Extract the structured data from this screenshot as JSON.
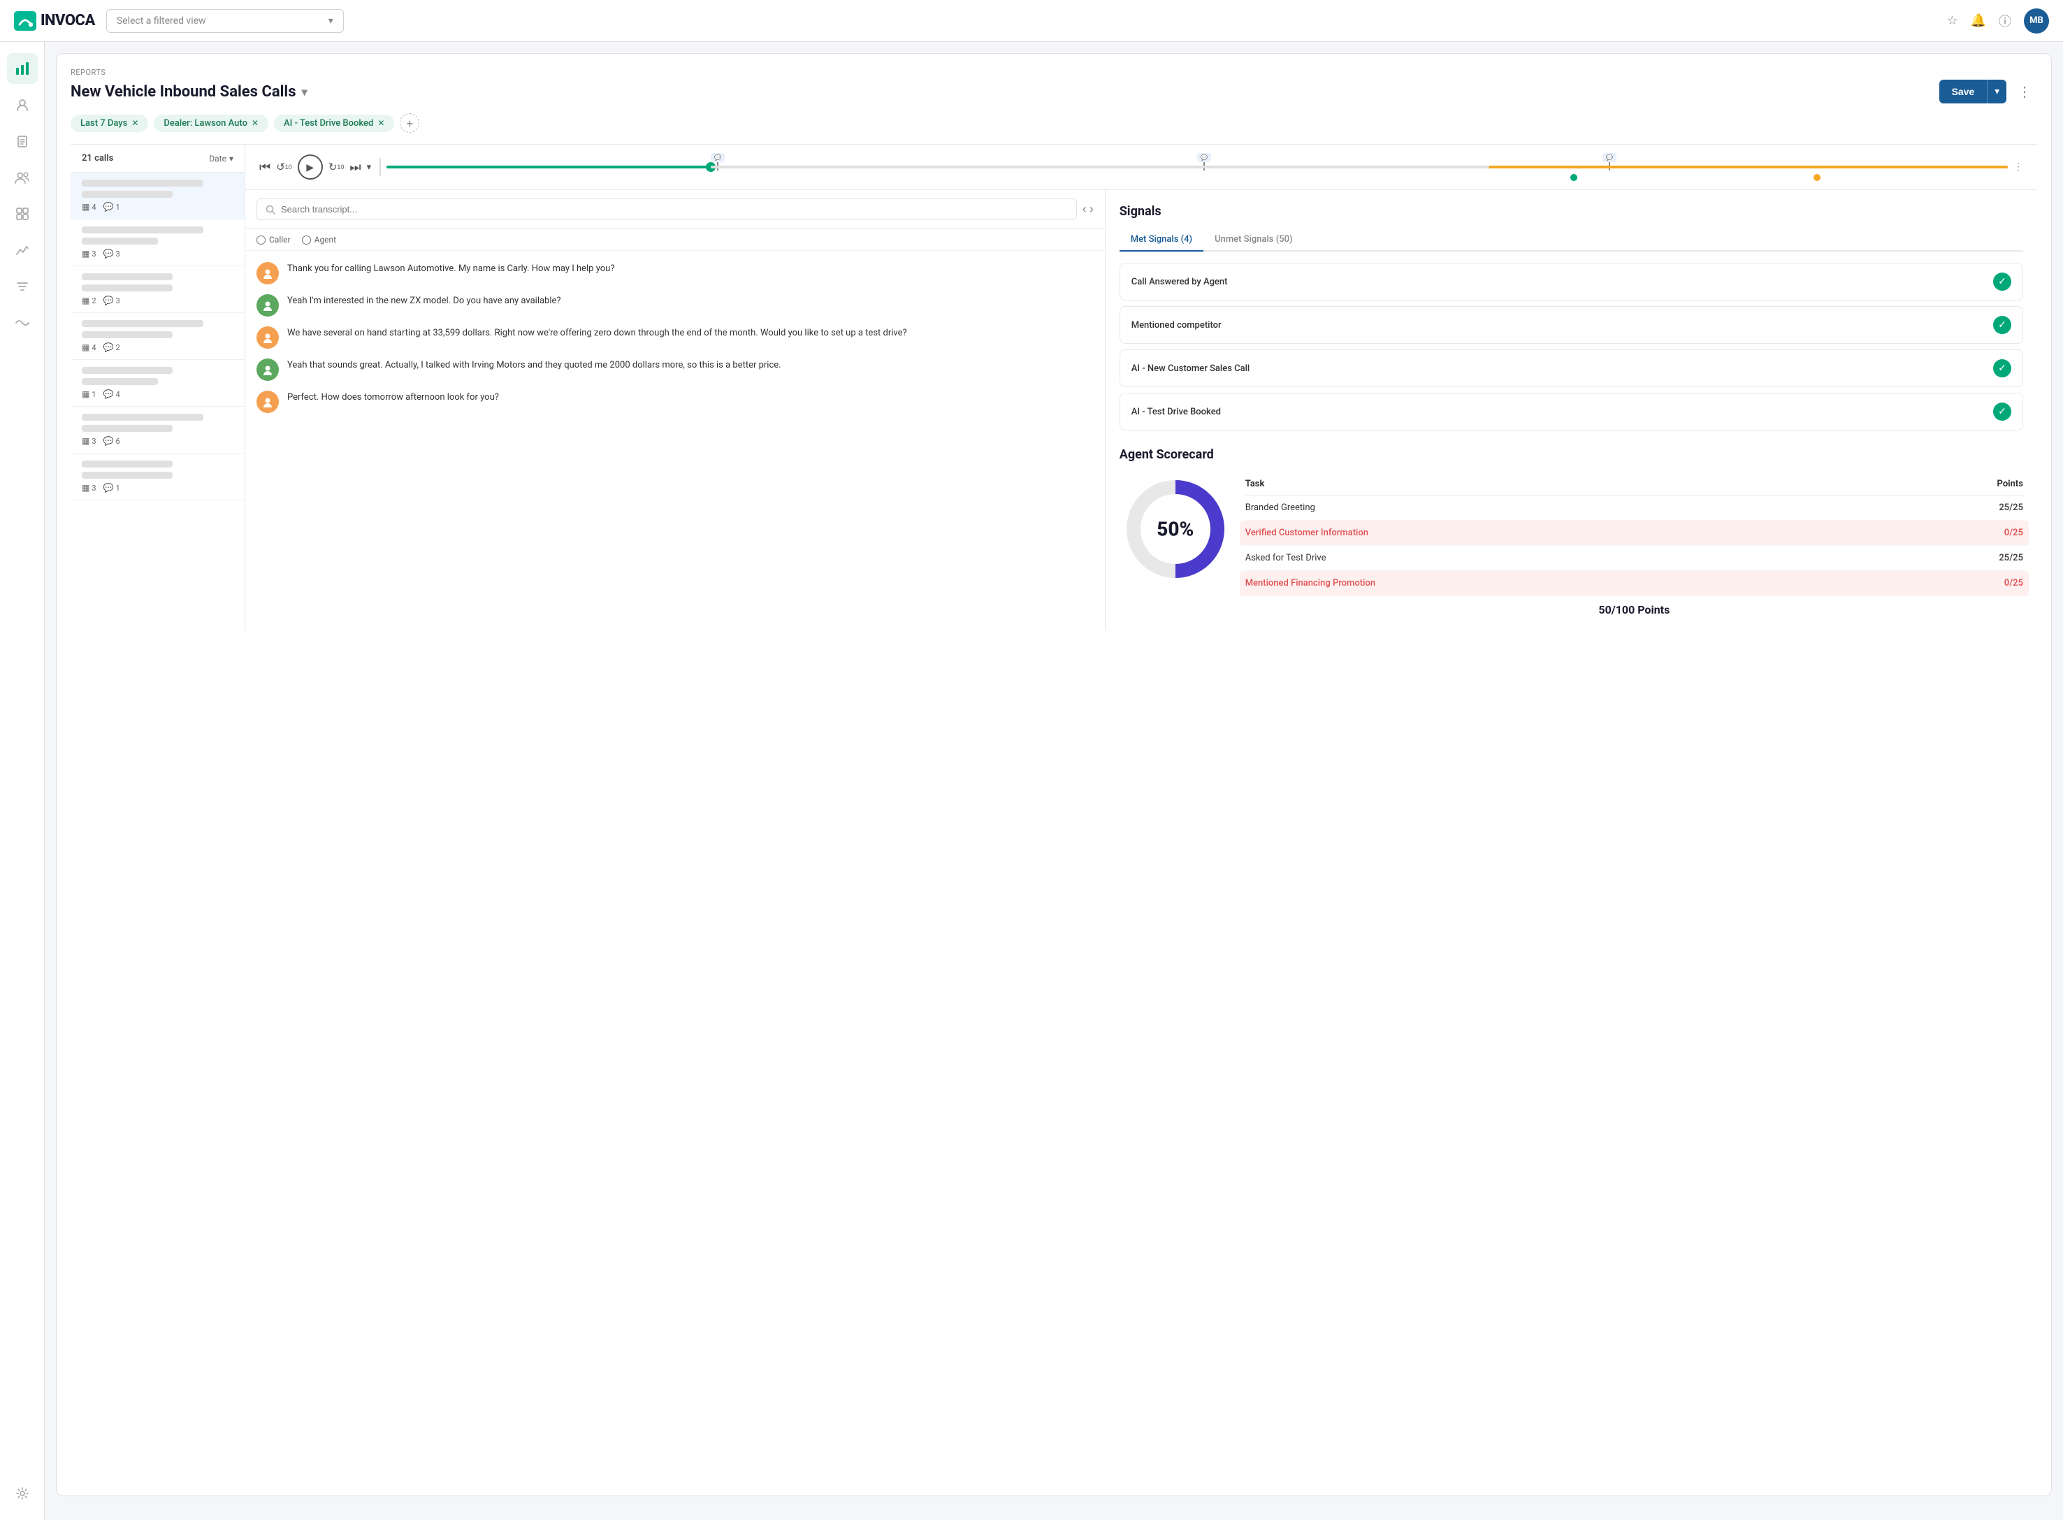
{
  "app": {
    "logo_text": "INVOCA",
    "nav_placeholder": "Select a filtered view",
    "user_initials": "MB"
  },
  "sidebar": {
    "items": [
      {
        "id": "analytics",
        "icon": "▦",
        "active": true
      },
      {
        "id": "contacts",
        "icon": "👤"
      },
      {
        "id": "clipboard",
        "icon": "📋"
      },
      {
        "id": "team",
        "icon": "👥"
      },
      {
        "id": "grid",
        "icon": "⊞"
      },
      {
        "id": "chart",
        "icon": "📈"
      },
      {
        "id": "filter",
        "icon": "⚙"
      },
      {
        "id": "wifi",
        "icon": "📡"
      }
    ],
    "bottom_item": {
      "id": "settings",
      "icon": "⚙"
    }
  },
  "report": {
    "breadcrumb": "REPORTS",
    "title": "New Vehicle Inbound Sales Calls",
    "save_label": "Save",
    "filters": [
      {
        "label": "Last 7 Days"
      },
      {
        "label": "Dealer: Lawson Auto"
      },
      {
        "label": "AI - Test Drive Booked"
      }
    ]
  },
  "call_list": {
    "count": "21 calls",
    "sort_label": "Date",
    "items": [
      {
        "bars": [
          "long",
          "medium"
        ],
        "meta": [
          {
            "icon": "▦",
            "count": "4"
          },
          {
            "icon": "💬",
            "count": "1"
          }
        ],
        "active": true
      },
      {
        "bars": [
          "long",
          "short"
        ],
        "meta": [
          {
            "icon": "▦",
            "count": "3"
          },
          {
            "icon": "💬",
            "count": "3"
          }
        ]
      },
      {
        "bars": [
          "medium",
          "medium"
        ],
        "meta": [
          {
            "icon": "▦",
            "count": "2"
          },
          {
            "icon": "💬",
            "count": "3"
          }
        ]
      },
      {
        "bars": [
          "long",
          "medium"
        ],
        "meta": [
          {
            "icon": "▦",
            "count": "4"
          },
          {
            "icon": "💬",
            "count": "2"
          }
        ]
      },
      {
        "bars": [
          "medium",
          "short"
        ],
        "meta": [
          {
            "icon": "▦",
            "count": "1"
          },
          {
            "icon": "💬",
            "count": "4"
          }
        ]
      },
      {
        "bars": [
          "long",
          "medium"
        ],
        "meta": [
          {
            "icon": "▦",
            "count": "3"
          },
          {
            "icon": "💬",
            "count": "6"
          }
        ]
      },
      {
        "bars": [
          "medium",
          "medium"
        ],
        "meta": [
          {
            "icon": "▦",
            "count": "3"
          },
          {
            "icon": "💬",
            "count": "1"
          }
        ]
      }
    ]
  },
  "player": {
    "rewind_label": "⏮",
    "back10_label": "↺",
    "play_label": "▶",
    "fwd10_label": "↻",
    "skip_label": "⏭",
    "chevron": "▾"
  },
  "transcript": {
    "search_placeholder": "Search transcript...",
    "caller_label": "Caller",
    "agent_label": "Agent",
    "messages": [
      {
        "speaker": "agent",
        "text": "Thank you for calling Lawson Automotive. My name is Carly. How may I help you?"
      },
      {
        "speaker": "caller",
        "text": "Yeah I'm interested in the new ZX model. Do you have any available?"
      },
      {
        "speaker": "agent",
        "text": "We have several on hand starting at 33,599 dollars. Right now we're offering zero down through the end of the month. Would you like to set up a test drive?"
      },
      {
        "speaker": "caller",
        "text": "Yeah that sounds great. Actually, I talked with Irving Motors and they quoted me 2000 dollars more, so this is a better price."
      },
      {
        "speaker": "agent",
        "text": "Perfect. How does tomorrow afternoon look for you?"
      }
    ]
  },
  "signals": {
    "title": "Signals",
    "met_tab": "Met Signals (4)",
    "unmet_tab": "Unmet Signals (50)",
    "met_items": [
      {
        "name": "Call Answered by Agent"
      },
      {
        "name": "Mentioned competitor"
      },
      {
        "name": "AI - New Customer Sales Call"
      },
      {
        "name": "AI - Test Drive Booked"
      }
    ]
  },
  "scorecard": {
    "title": "Agent Scorecard",
    "percentage": "50%",
    "points_label": "50/100 Points",
    "table_header_task": "Task",
    "table_header_points": "Points",
    "rows": [
      {
        "task": "Branded Greeting",
        "points": "25/25",
        "fail": false
      },
      {
        "task": "Verified Customer Information",
        "points": "0/25",
        "fail": true
      },
      {
        "task": "Asked for Test Drive",
        "points": "25/25",
        "fail": false
      },
      {
        "task": "Mentioned Financing Promotion",
        "points": "0/25",
        "fail": true
      }
    ]
  }
}
